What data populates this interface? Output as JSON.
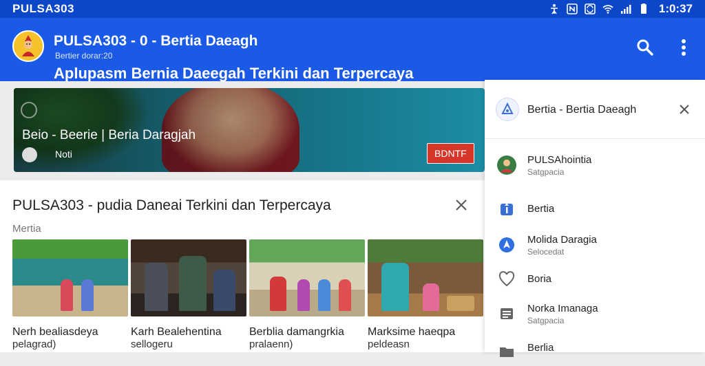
{
  "status_bar": {
    "app_name": "PULSA303",
    "time": "1:0:37",
    "icons": [
      "accessibility-icon",
      "nfc-icon",
      "sync-icon",
      "wifi-icon",
      "signal-icon",
      "battery-icon"
    ]
  },
  "app_bar": {
    "title": "PULSA303 - 0 - Bertia Daeagh",
    "subtitle": "Bertier dorar:20",
    "tagline": "Aplupasm Bernia Daeegah Terkini dan Terpercaya",
    "search_icon": "search-icon",
    "menu_icon": "more-vert-icon"
  },
  "hero": {
    "title": "Beio - Beerie | Beria Daragjah",
    "meta": "Noti",
    "badge": "BDNTF"
  },
  "card": {
    "title": "PULSA303 - pudia Daneai Terkini dan Terpercaya",
    "section": "Mertia",
    "items": [
      {
        "title": "Nerh bealiasdeya",
        "sub": "pelagrad)"
      },
      {
        "title": "Karh Bealehentina",
        "sub": "sellogeru"
      },
      {
        "title": "Berblia damangrkia",
        "sub": "pralaenn)"
      },
      {
        "title": "Marksime haeqpa",
        "sub": "peldeasn"
      }
    ]
  },
  "panel": {
    "title": "Bertia - Bertia Daeagh",
    "items": [
      {
        "label": "PULSAhointia",
        "sub": "Satgpacia",
        "icon": "avatar-icon"
      },
      {
        "label": "Bertia",
        "sub": "",
        "icon": "info-icon"
      },
      {
        "label": "Molida Daragia",
        "sub": "Selocedat",
        "icon": "location-icon"
      },
      {
        "label": "Boria",
        "sub": "",
        "icon": "heart-icon"
      },
      {
        "label": "Norka Imanaga",
        "sub": "Satgpacia",
        "icon": "newspaper-icon"
      },
      {
        "label": "Berlia",
        "sub": "",
        "icon": "folder-icon"
      }
    ]
  },
  "colors": {
    "brand_blue": "#1b5ae6",
    "status_blue": "#0d47c9",
    "badge_red": "#d6352a"
  }
}
